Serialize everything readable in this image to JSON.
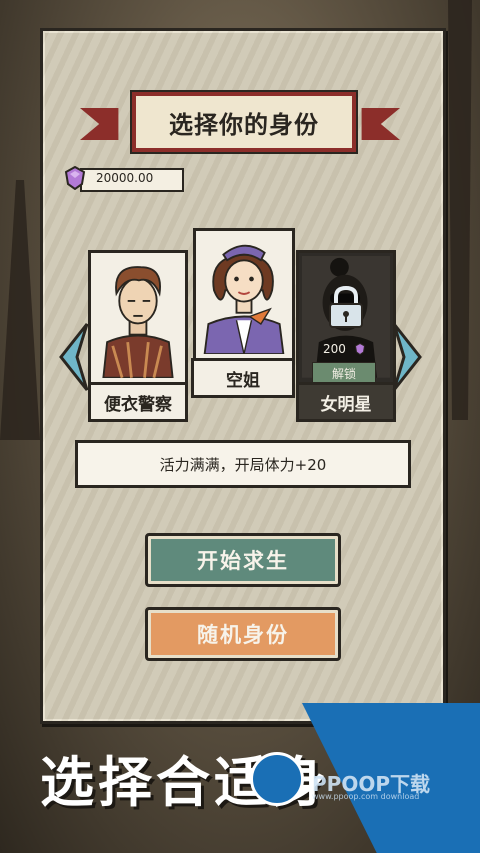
{
  "header": {
    "title": "选择你的身份"
  },
  "currency": {
    "icon": "purple-gem-icon",
    "value": "20000.00"
  },
  "characters": [
    {
      "name": "便衣警察",
      "locked": false
    },
    {
      "name": "空姐",
      "locked": false,
      "selected": true
    },
    {
      "name": "女明星",
      "locked": true,
      "price": "200",
      "unlock_label": "解锁"
    }
  ],
  "description": "活力满满，开局体力+20",
  "buttons": {
    "start": "开始求生",
    "random": "随机身份"
  },
  "caption": "选择合适身",
  "watermark": {
    "text": "PPOOP下载",
    "sub": "www.ppoop.com download"
  },
  "colors": {
    "start": "#5f8a7c",
    "random": "#e39a62",
    "banner": "#8c2e2a",
    "gem": "#b37ad6",
    "arrow": "#6fb6c8"
  }
}
